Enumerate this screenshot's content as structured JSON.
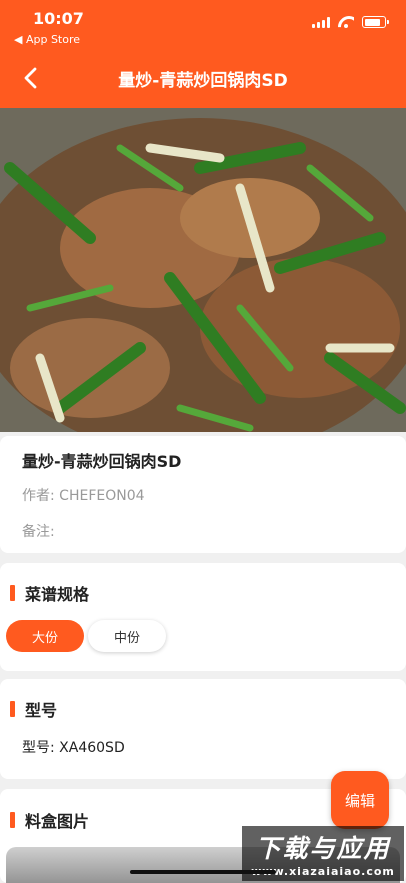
{
  "status_bar": {
    "time": "10:07",
    "back_app": "◀ App Store",
    "battery_level": 0.8
  },
  "header": {
    "title": "量炒-青蒜炒回锅肉SD"
  },
  "dish": {
    "name": "量炒-青蒜炒回锅肉SD",
    "author": "作者: CHEFEON04",
    "remark": "备注:"
  },
  "spec": {
    "title": "菜谱规格",
    "options": [
      "大份",
      "中份"
    ],
    "selected": "大份"
  },
  "model": {
    "title": "型号",
    "value": "型号: XA460SD"
  },
  "box_image": {
    "title": "料盒图片"
  },
  "fab": {
    "label": "编辑"
  },
  "watermark": {
    "main": "下载与应用",
    "sub": "www.xiazaiaiao.com"
  },
  "colors": {
    "accent": "#ff5a1f",
    "background": "#f0f0f0"
  }
}
